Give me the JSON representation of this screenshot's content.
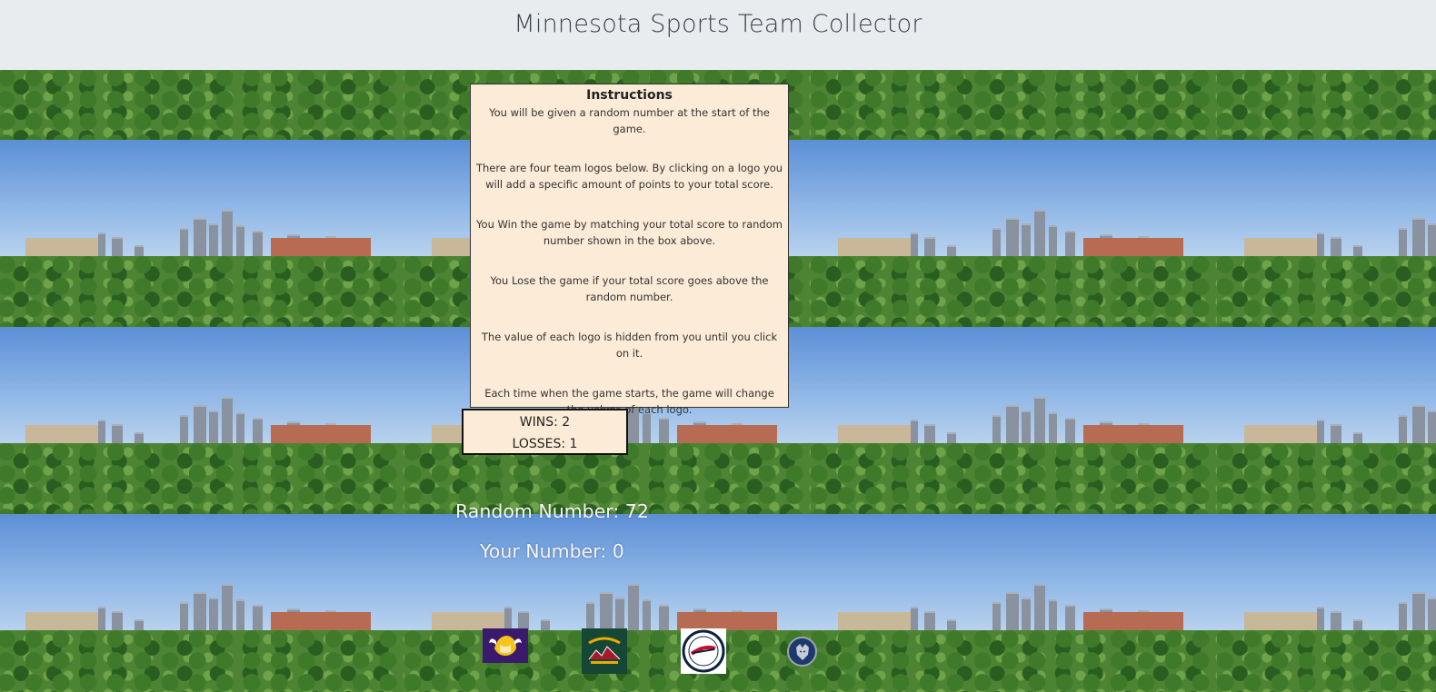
{
  "header": {
    "title": "Minnesota Sports Team Collector"
  },
  "instructions": {
    "heading": "Instructions",
    "paragraphs": [
      "You will be given a random number at the start of the game.",
      "There are four team logos below. By clicking on a logo you will add a specific amount of points to your total score.",
      "You Win the game by matching your total score to random number shown in the box above.",
      "You Lose the game if your total score goes above the random number.",
      "The value of each logo is hidden from you until you click on it.",
      "Each time when the game starts, the game will change the values of each logo."
    ]
  },
  "record": {
    "wins": "WINS: 2",
    "losses": "LOSSES: 1"
  },
  "game": {
    "random_number": "Random Number: 72",
    "your_number": "Your Number: 0"
  },
  "logos": [
    {
      "icon": "vikings-logo-icon",
      "color": "#3b1a6e"
    },
    {
      "icon": "wild-logo-icon",
      "color": "#154734"
    },
    {
      "icon": "twins-logo-icon",
      "color": "#0c2340"
    },
    {
      "icon": "timberwolves-logo-icon",
      "color": "#1b3a6b"
    }
  ]
}
